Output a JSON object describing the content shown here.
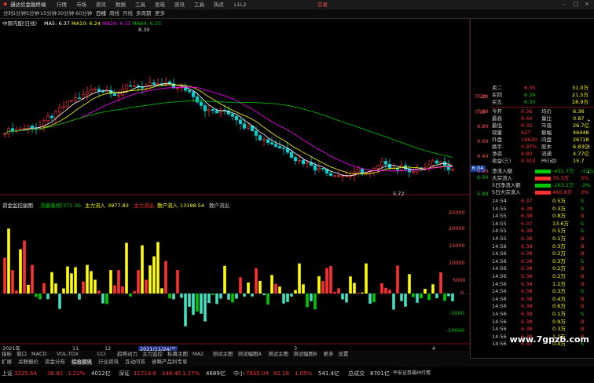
{
  "topbar": {
    "app_title": "通达信金融终端",
    "menus": [
      "行情",
      "市场",
      "资讯",
      "数据",
      "工具",
      "发现",
      "资讯",
      "工具",
      "热点",
      "L1L2"
    ],
    "right_label": "交易"
  },
  "periodbar": {
    "items": [
      "分时",
      "1分钟",
      "5分钟",
      "15分钟",
      "30分钟",
      "60分钟",
      "日线",
      "周线",
      "月线",
      "多周期",
      "更多"
    ]
  },
  "chart_header": {
    "stock": "中原内配(日线)",
    "ma5": "MA5: 6.37",
    "ma10": "MA10: 6.24",
    "ma20": "MA20: 6.15",
    "ma60": "MA60: 6.33",
    "high_mark": "8.30",
    "low_mark": "5.72",
    "price_tag": "6.04"
  },
  "price_axis": [
    "7.20",
    "7.00",
    "6.80",
    "6.60",
    "6.40",
    "6.20",
    "6.00",
    "5.80"
  ],
  "indicator": {
    "title": "资金监控副图",
    "items": [
      {
        "label": "流量基线",
        "value": "7371.36",
        "color": "#00c800"
      },
      {
        "label": "主力流入",
        "value": "3977.83",
        "color": "#ffff00"
      },
      {
        "label": "主力流出",
        "value": "",
        "color": "#ff0000"
      },
      {
        "label": "散户流入",
        "value": "13188.54",
        "color": "#ffff00"
      },
      {
        "label": "散户流出",
        "value": "",
        "color": "#cccccc"
      }
    ],
    "axis": [
      "25000",
      "20000",
      "15000",
      "10000",
      "5000",
      "0",
      "-5000",
      "-10000"
    ]
  },
  "date_axis": {
    "left": "2021年",
    "marks": [
      "11",
      "12",
      "2021/11/24/三",
      "3",
      "4"
    ]
  },
  "quote": {
    "asks": [
      {
        "label": "卖二",
        "price": "6.35",
        "vol": "31.0万"
      },
      {
        "label": "买四",
        "price": "6.34",
        "vol": "21.5万"
      },
      {
        "label": "买五",
        "price": "6.33",
        "vol": "28.9万"
      }
    ],
    "stats": [
      {
        "l1": "今开",
        "v1": "6.36",
        "l2": "均价",
        "v2": "6.36"
      },
      {
        "l1": "最高",
        "v1": "6.40",
        "l2": "量比",
        "v2": "0.87"
      },
      {
        "l1": "最低",
        "v1": "6.32",
        "l2": "市值",
        "v2": "26.7亿"
      },
      {
        "l1": "现量",
        "v1": "627",
        "l2": "振幅",
        "v2": "46448"
      },
      {
        "l1": "外盘",
        "v1": "19630",
        "l2": "内盘",
        "v2": "26718"
      },
      {
        "l1": "换手",
        "v1": "0.97%",
        "l2": "股本",
        "v2": "6.83亿"
      },
      {
        "l1": "净资",
        "v1": "4.80",
        "l2": "流通",
        "v2": "4.77亿"
      },
      {
        "l1": "收益(三)",
        "v1": "0.310",
        "l2": "PE(动)",
        "v2": "15.7"
      }
    ],
    "flows": [
      {
        "label": "净流入额",
        "value": "-451.7万",
        "pct": "-15%",
        "color": "#00c800"
      },
      {
        "label": "大宗流入",
        "value": "76.3万",
        "pct": "3%",
        "color": "#ff3030"
      },
      {
        "label": "5日净流入额",
        "value": "-263.1万",
        "pct": "-2%",
        "color": "#00c800"
      },
      {
        "label": "5日大宗流入",
        "value": "460.8万",
        "pct": "3%",
        "color": "#ff3030"
      }
    ],
    "ticks": [
      {
        "time": "14:54",
        "price": "6.37",
        "vol": "0.5万",
        "side": "S"
      },
      {
        "time": "14:55",
        "price": "6.38",
        "vol": "0.3万",
        "side": "S"
      },
      {
        "time": "14:55",
        "price": "6.38",
        "vol": "0.8万",
        "side": "B"
      },
      {
        "time": "14:55",
        "price": "6.37",
        "vol": "13.6万",
        "side": "S"
      },
      {
        "time": "14:55",
        "price": "6.38",
        "vol": "0.5万",
        "side": "S"
      },
      {
        "time": "14:55",
        "price": "6.38",
        "vol": "0.1万",
        "side": "B"
      },
      {
        "time": "14:56",
        "price": "6.38",
        "vol": "0.3万",
        "side": "B"
      },
      {
        "time": "14:56",
        "price": "6.38",
        "vol": "0.2万",
        "side": "B"
      },
      {
        "time": "14:56",
        "price": "6.38",
        "vol": "0.3万",
        "side": "S"
      },
      {
        "time": "14:56",
        "price": "6.38",
        "vol": "0.2万",
        "side": "B"
      },
      {
        "time": "14:56",
        "price": "6.38",
        "vol": "0.2万",
        "side": "B"
      },
      {
        "time": "14:56",
        "price": "6.38",
        "vol": "1.2万",
        "side": "B"
      },
      {
        "time": "14:56",
        "price": "6.38",
        "vol": "0.3万",
        "side": "S"
      },
      {
        "time": "14:56",
        "price": "6.38",
        "vol": "0.4万",
        "side": "B"
      },
      {
        "time": "14:56",
        "price": "6.38",
        "vol": "0.6万",
        "side": "B"
      },
      {
        "time": "14:56",
        "price": "6.38",
        "vol": "0.1万",
        "side": "S"
      },
      {
        "time": "14:56",
        "price": "6.38",
        "vol": "0.9万",
        "side": "B"
      },
      {
        "time": "14:56",
        "price": "6.38",
        "vol": "0.3万",
        "side": "B"
      },
      {
        "time": "14:56",
        "price": "6.38",
        "vol": "1.1万",
        "side": "B"
      },
      {
        "time": "14:56",
        "price": "6.37",
        "vol": "0.4万",
        "side": "S"
      }
    ]
  },
  "bottom_tabs": [
    "指标",
    "窗口",
    "MACD",
    "VOL-TDX",
    "CCI",
    "趋势动力",
    "主力监控",
    "私募主图",
    "MA2",
    "测试主图",
    "测试幅图A",
    "测试主图",
    "测试幅图B",
    "更多",
    "设置"
  ],
  "bottom_tabs2": [
    "扩展",
    "关联报价",
    "资金分布",
    "综合资讯",
    "行业资讯",
    "互动问答",
    "省略产品利专享"
  ],
  "status": {
    "index1": {
      "name": "上证",
      "value": "3225.64",
      "chg": "38.82",
      "pct": "1.22%",
      "amt": "4012亿"
    },
    "index2": {
      "name": "深证",
      "value": "11714.6",
      "chg": "146.45",
      "pct": "1.27%",
      "amt": "4689亿"
    },
    "index3": {
      "name": "中小",
      "value": "7835.04",
      "chg": "82.18",
      "pct": "1.05%",
      "amt": "541.4亿"
    },
    "total": {
      "label": "总成交",
      "value": "8701亿"
    },
    "broker": "平安证券福州行情"
  },
  "watermark": "www.7gpzb.com",
  "colors": {
    "up": "#ff3030",
    "down": "#00d0d0",
    "ma5": "#ffffff",
    "ma10": "#ffff00",
    "ma20": "#ff00ff",
    "ma60": "#00c800"
  }
}
